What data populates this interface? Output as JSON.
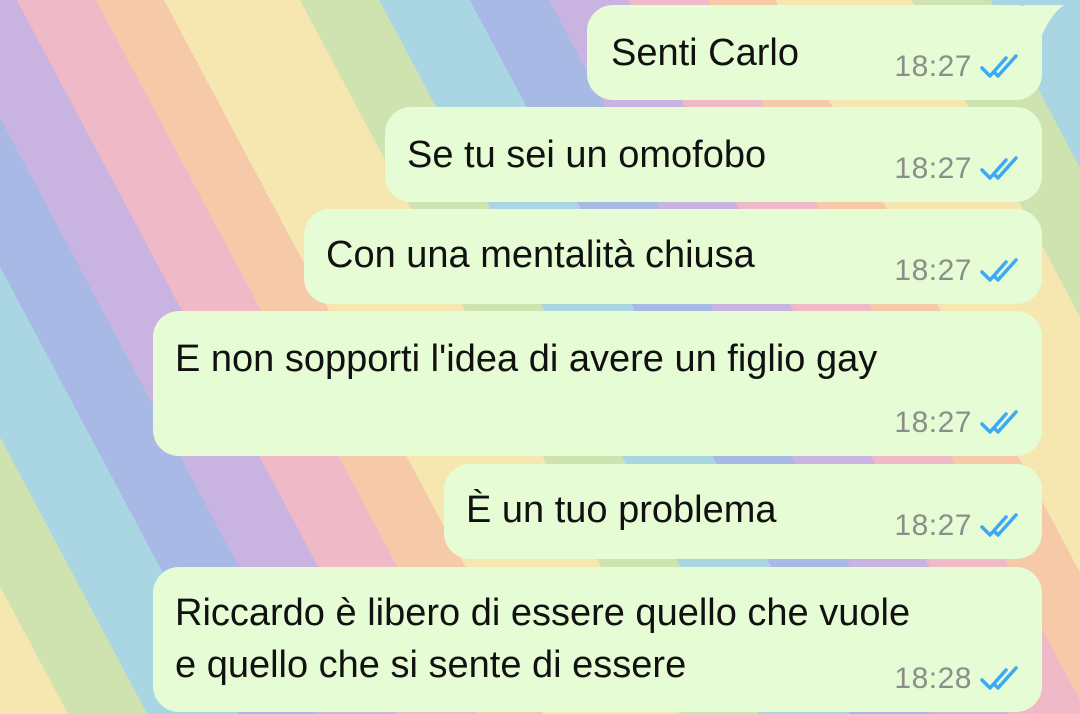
{
  "colors": {
    "bubble_outgoing": "#e5fcd4",
    "tick_read": "#3da9f4",
    "time_text": "#8a8f8a"
  },
  "messages": [
    {
      "text": "Senti Carlo",
      "time": "18:27",
      "status": "read-double-check-icon"
    },
    {
      "text": "Se tu sei un omofobo",
      "time": "18:27",
      "status": "read-double-check-icon"
    },
    {
      "text": "Con una mentalità chiusa",
      "time": "18:27",
      "status": "read-double-check-icon"
    },
    {
      "text": "E non sopporti l'idea di avere un figlio gay",
      "time": "18:27",
      "status": "read-double-check-icon"
    },
    {
      "text": "È un tuo problema",
      "time": "18:27",
      "status": "read-double-check-icon"
    },
    {
      "text_lines": [
        "Riccardo è libero di essere quello che vuole",
        "e quello che si sente di essere"
      ],
      "time": "18:28",
      "status": "read-double-check-icon"
    }
  ]
}
